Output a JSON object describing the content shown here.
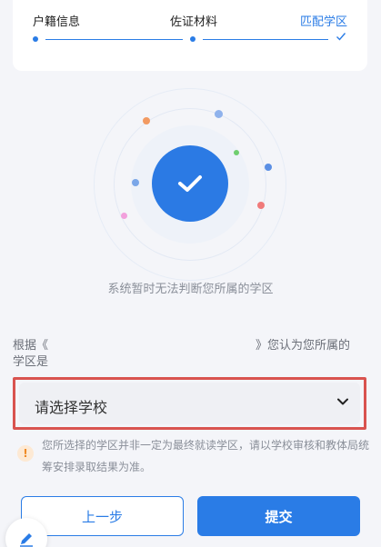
{
  "steps": [
    {
      "label": "户籍信息",
      "state": "done"
    },
    {
      "label": "佐证材料",
      "state": "done"
    },
    {
      "label": "匹配学区",
      "state": "active"
    }
  ],
  "status_message": "系统暂时无法判断您所属的学区",
  "prompt": {
    "prefix": "根据《",
    "suffix": "》您认为您所属的",
    "line2": "学区是"
  },
  "school_select": {
    "value": "请选择学校"
  },
  "notice": "您所选择的学区并非一定为最终就读学区，请以学校审核和教体局统筹安排录取结果为准。",
  "buttons": {
    "prev": "上一步",
    "submit": "提交"
  },
  "colors": {
    "accent": "#2a7ce6",
    "warning": "#f08a24",
    "highlight_border": "#d9534f"
  },
  "icons": {
    "center": "checkmark-icon",
    "select": "chevron-down-icon",
    "notice": "exclamation-icon",
    "fab": "pencil-icon"
  }
}
